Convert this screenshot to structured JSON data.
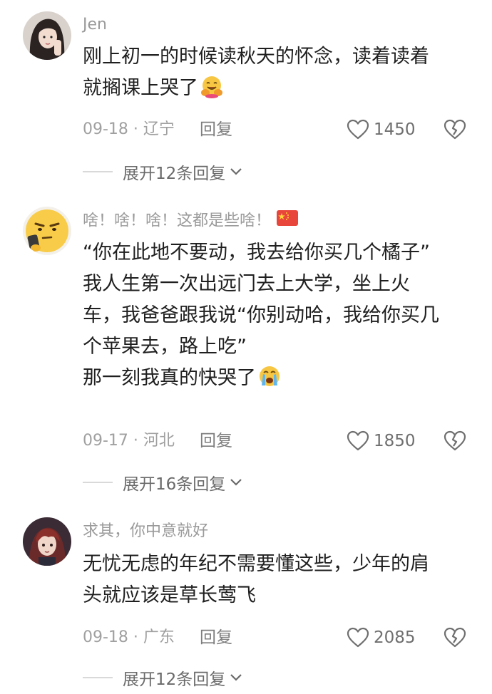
{
  "comments": [
    {
      "username": "Jen",
      "text_lines": [
        "刚上初一的时候读秋天的怀念，读着读着",
        "就搁课上哭了"
      ],
      "date_location": "09-18 · 辽宁",
      "reply_label": "回复",
      "likes": "1450",
      "expand_label": "展开12条回复"
    },
    {
      "username": "啥！啥！啥！这都是些啥！",
      "text_lines": [
        "“你在此地不要动，我去给你买几个橘子”",
        "我人生第一次出远门去上大学，坐上火",
        "车，我爸爸跟我说“你别动哈，我给你买几",
        "个苹果去，路上吃”",
        "那一刻我真的快哭了"
      ],
      "date_location": "09-17 · 河北",
      "reply_label": "回复",
      "likes": "1850",
      "expand_label": "展开16条回复"
    },
    {
      "username": "求其，你中意就好",
      "text_lines": [
        "无忧无虑的年纪不需要懂这些，少年的肩",
        "头就应该是草长莺飞"
      ],
      "date_location": "09-18 · 广东",
      "reply_label": "回复",
      "likes": "2085",
      "expand_label": "展开12条回复"
    }
  ],
  "icons": {
    "like": "heart-outline-icon",
    "dislike": "broken-heart-icon",
    "expand": "chevron-down-icon",
    "hug_emoji": "hugging-face-emoji",
    "cry_emoji": "crying-face-emoji",
    "flag": "china-flag-icon"
  },
  "colors": {
    "secondary_text": "#9a9a9a",
    "body_text": "#1f1f1f",
    "icon": "#6f6f6f"
  }
}
